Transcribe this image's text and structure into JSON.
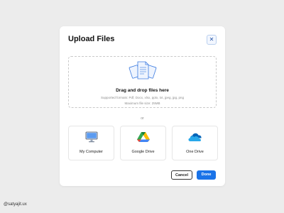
{
  "modal": {
    "title": "Upload Files",
    "close_symbol": "✕",
    "close_icon": "close-icon"
  },
  "dropzone": {
    "icon": "documents-icon",
    "title": "Drag and drop files here",
    "formats": "Supported formats: Pdf, Docx, xlsx, pptx, txt, jpeg, jpg, png",
    "max_size": "Maximum file size: 25MB"
  },
  "separator": "or",
  "sources": [
    {
      "label": "My Computer",
      "icon": "computer-icon"
    },
    {
      "label": "Google Drive",
      "icon": "google-drive-icon"
    },
    {
      "label": "One Drive",
      "icon": "onedrive-icon"
    }
  ],
  "actions": {
    "cancel_label": "Cancel",
    "done_label": "Done"
  },
  "watermark": "@satyajit.ux",
  "colors": {
    "accent": "#1a73e8",
    "background": "#ececec",
    "icon_blue": "#3c7be0"
  }
}
